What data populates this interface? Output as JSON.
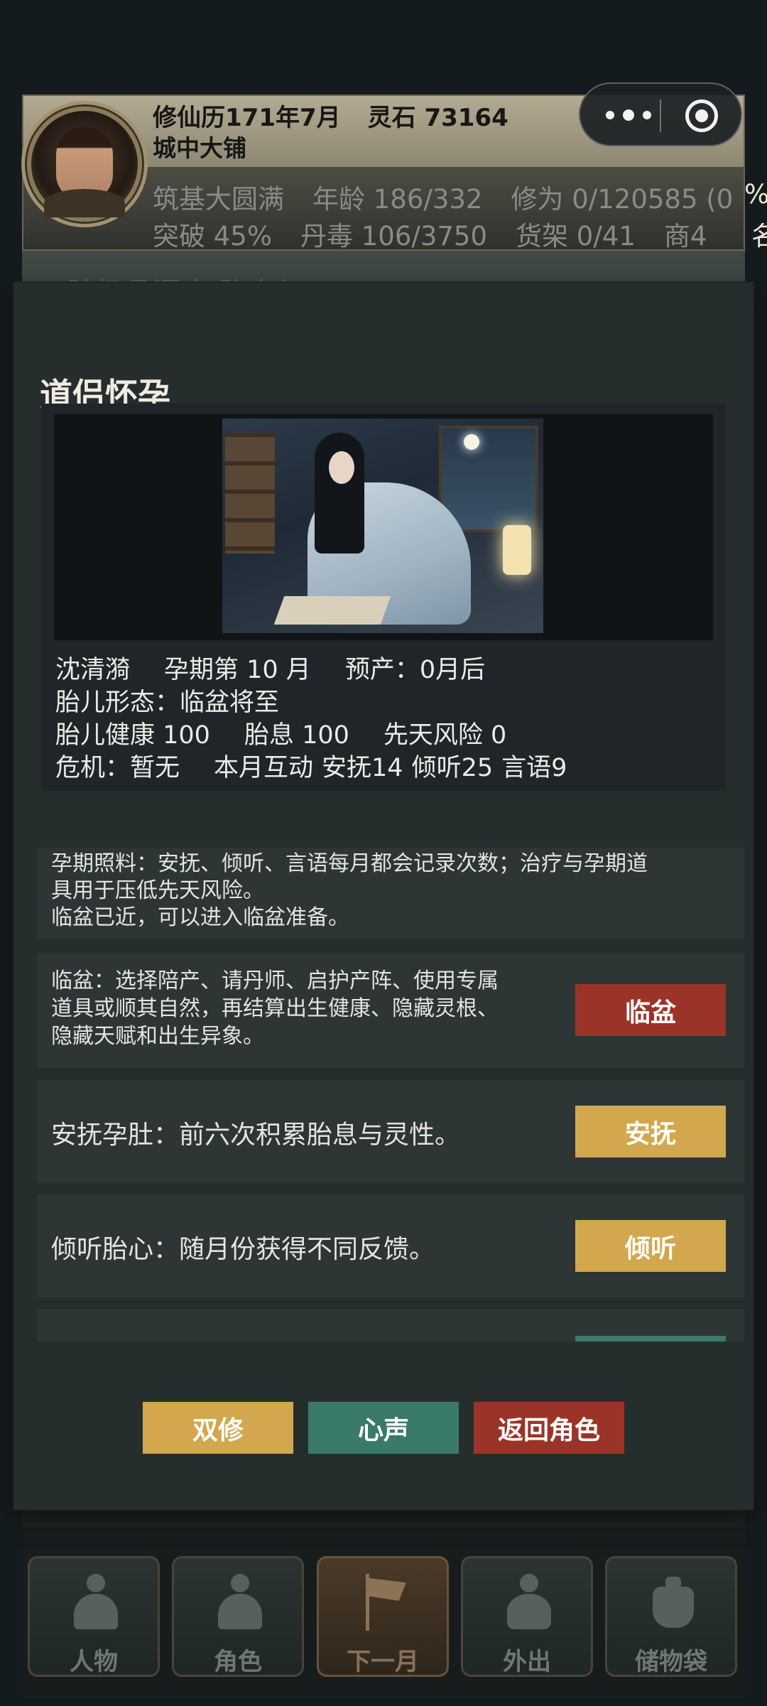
{
  "header": {
    "calendar": "修仙历171年7月",
    "spirit_stones": "灵石 73164",
    "location": "城中大铺",
    "stats_row1": [
      "筑基大圆满",
      "年龄 186/332",
      "修为 0/120585 (0"
    ],
    "stats_row2": [
      "突破 45%",
      "丹毒 106/3750",
      "货架 0/41",
      "商4"
    ],
    "overflow_pct": "%",
    "overflow_ming": "名"
  },
  "background": {
    "ghost_text": "三阶极品洞府 路十与"
  },
  "modal": {
    "title": "道侣怀孕",
    "info": {
      "name": "沈清漪",
      "pregnancy_month": "孕期第 10 月",
      "due": "预产：0月后",
      "fetal_form": "胎儿形态：临盆将至",
      "health": "胎儿健康 100",
      "fetal_breath": "胎息 100",
      "innate_risk": "先天风险 0",
      "crisis": "危机：暂无",
      "interaction_label": "本月互动",
      "soothe_count": "安抚14",
      "listen_count": "倾听25",
      "speech_count": "言语9"
    },
    "note": {
      "line1": "孕期照料：安抚、倾听、言语每月都会记录次数；治疗与孕期道",
      "line2": "具用于压低先天风险。",
      "line3": "临盆已近，可以进入临盆准备。"
    },
    "actions": [
      {
        "desc_line1": "临盆：选择陪产、请丹师、启护产阵、使用专属",
        "desc_line2": "道具或顺其自然，再结算出生健康、隐藏灵根、",
        "desc_line3": "隐藏天赋和出生异象。",
        "button": "临盆"
      },
      {
        "desc": "安抚孕肚：前六次积累胎息与灵性。",
        "button": "安抚"
      },
      {
        "desc": "倾听胎心：随月份获得不同反馈。",
        "button": "倾听"
      }
    ],
    "bottom_buttons": {
      "dual_cultivation": "双修",
      "inner_voice": "心声",
      "back_to_role": "返回角色"
    }
  },
  "tabbar": {
    "tabs": [
      {
        "label": "人物",
        "icon": "person-icon"
      },
      {
        "label": "角色",
        "icon": "role-icon"
      },
      {
        "label": "下一月",
        "icon": "flag-icon"
      },
      {
        "label": "外出",
        "icon": "lotus-icon"
      },
      {
        "label": "储物袋",
        "icon": "bag-icon"
      }
    ]
  },
  "colors": {
    "modal_bg": "#262e2d",
    "button_red": "#9b3428",
    "button_gold": "#d2a74d",
    "button_teal": "#3a7a68"
  }
}
